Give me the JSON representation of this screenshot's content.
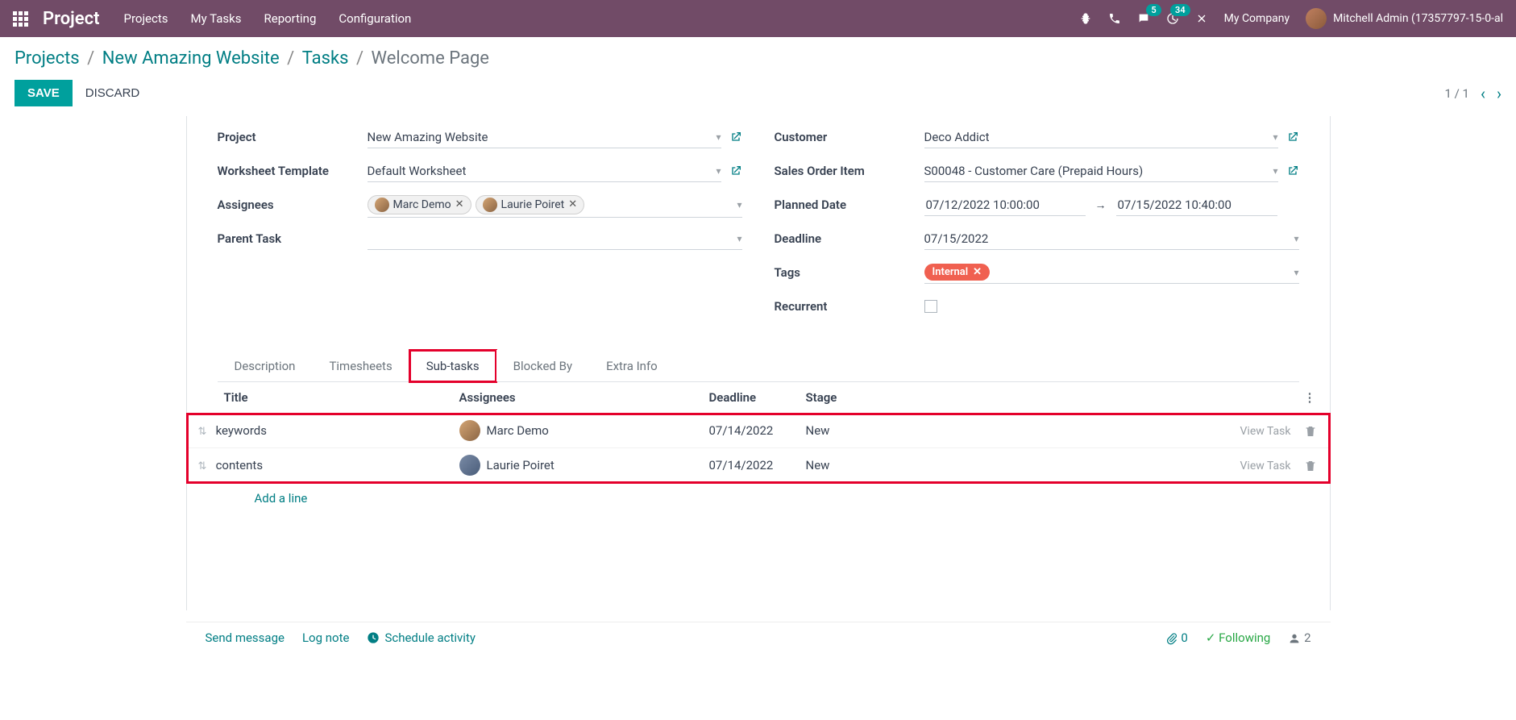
{
  "header": {
    "brand": "Project",
    "nav": [
      "Projects",
      "My Tasks",
      "Reporting",
      "Configuration"
    ],
    "chat_badge": "5",
    "activity_badge": "34",
    "company": "My Company",
    "user": "Mitchell Admin (17357797-15-0-al"
  },
  "breadcrumb": {
    "projects": "Projects",
    "project_name": "New Amazing Website",
    "tasks": "Tasks",
    "current": "Welcome Page"
  },
  "actions": {
    "save": "SAVE",
    "discard": "DISCARD",
    "pager": "1 / 1"
  },
  "form": {
    "labels": {
      "project": "Project",
      "worksheet": "Worksheet Template",
      "assignees": "Assignees",
      "parent": "Parent Task",
      "customer": "Customer",
      "soitem": "Sales Order Item",
      "planned": "Planned Date",
      "deadline": "Deadline",
      "tags": "Tags",
      "recurrent": "Recurrent"
    },
    "project_val": "New Amazing Website",
    "worksheet_val": "Default Worksheet",
    "assignees": [
      {
        "name": "Marc Demo"
      },
      {
        "name": "Laurie Poiret"
      }
    ],
    "customer_val": "Deco Addict",
    "soitem_val": "S00048 - Customer Care (Prepaid Hours)",
    "planned_from": "07/12/2022 10:00:00",
    "planned_to": "07/15/2022 10:40:00",
    "deadline_val": "07/15/2022",
    "tag_val": "Internal"
  },
  "tabs": [
    "Description",
    "Timesheets",
    "Sub-tasks",
    "Blocked By",
    "Extra Info"
  ],
  "subtasks": {
    "columns": {
      "title": "Title",
      "assignees": "Assignees",
      "deadline": "Deadline",
      "stage": "Stage"
    },
    "rows": [
      {
        "title": "keywords",
        "assignee": "Marc Demo",
        "deadline": "07/14/2022",
        "stage": "New"
      },
      {
        "title": "contents",
        "assignee": "Laurie Poiret",
        "deadline": "07/14/2022",
        "stage": "New"
      }
    ],
    "view_task": "View Task",
    "add_line": "Add a line"
  },
  "chatter": {
    "send": "Send message",
    "log": "Log note",
    "schedule": "Schedule activity",
    "attach_count": "0",
    "following": "Following",
    "follower_count": "2"
  }
}
